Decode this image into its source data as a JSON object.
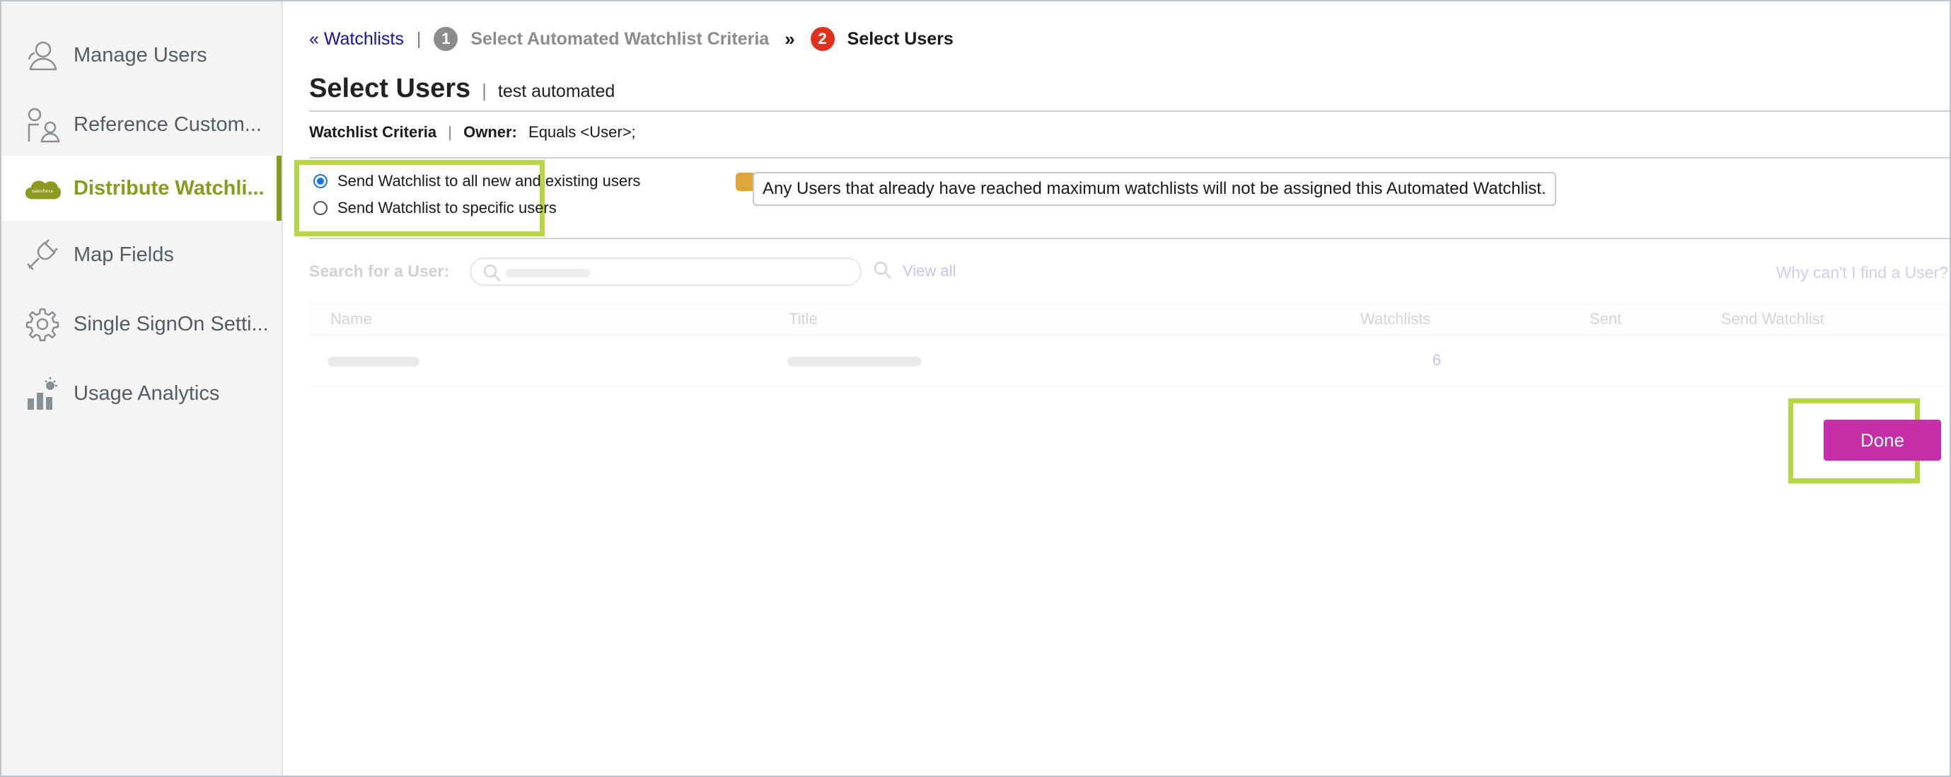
{
  "sidebar": {
    "items": [
      {
        "label": "Manage Users",
        "icon": "users-icon"
      },
      {
        "label": "Reference Custom...",
        "icon": "reference-customers-icon"
      },
      {
        "label": "Distribute Watchli...",
        "icon": "salesforce-cloud-icon",
        "active": true
      },
      {
        "label": "Map Fields",
        "icon": "plug-icon"
      },
      {
        "label": "Single SignOn Setti...",
        "icon": "gear-icon"
      },
      {
        "label": "Usage Analytics",
        "icon": "analytics-icon"
      }
    ],
    "cloud_text": "salesforce"
  },
  "breadcrumb": {
    "back_link": "« Watchlists",
    "separator": "|",
    "step1_number": "1",
    "step1_label": "Select Automated Watchlist Criteria",
    "arrow": "»",
    "step2_number": "2",
    "step2_label": "Select Users"
  },
  "header": {
    "title": "Select Users",
    "separator": "|",
    "watchlist_name": "test automated"
  },
  "criteria": {
    "label": "Watchlist Criteria",
    "separator": "|",
    "owner_label": "Owner:",
    "owner_value": "Equals <User>;"
  },
  "send_options": {
    "all_users_label": "Send Watchlist to all new and existing users",
    "specific_users_label": "Send Watchlist to specific users",
    "selected": "all"
  },
  "notice": {
    "text": "Any Users that already have reached maximum watchlists will not be assigned this Automated Watchlist."
  },
  "search": {
    "label": "Search for a User:",
    "view_all": "View all",
    "help_link": "Why can't I find a User?"
  },
  "table": {
    "columns": [
      "Name",
      "Title",
      "Watchlists",
      "Sent",
      "Send Watchlist"
    ],
    "rows": [
      {
        "watchlists": "6"
      }
    ]
  },
  "actions": {
    "done_label": "Done"
  },
  "colors": {
    "accent_green": "#8a9a1e",
    "highlight_green": "#b6d643",
    "done_button": "#c72fa8",
    "step_active": "#e0301e"
  }
}
